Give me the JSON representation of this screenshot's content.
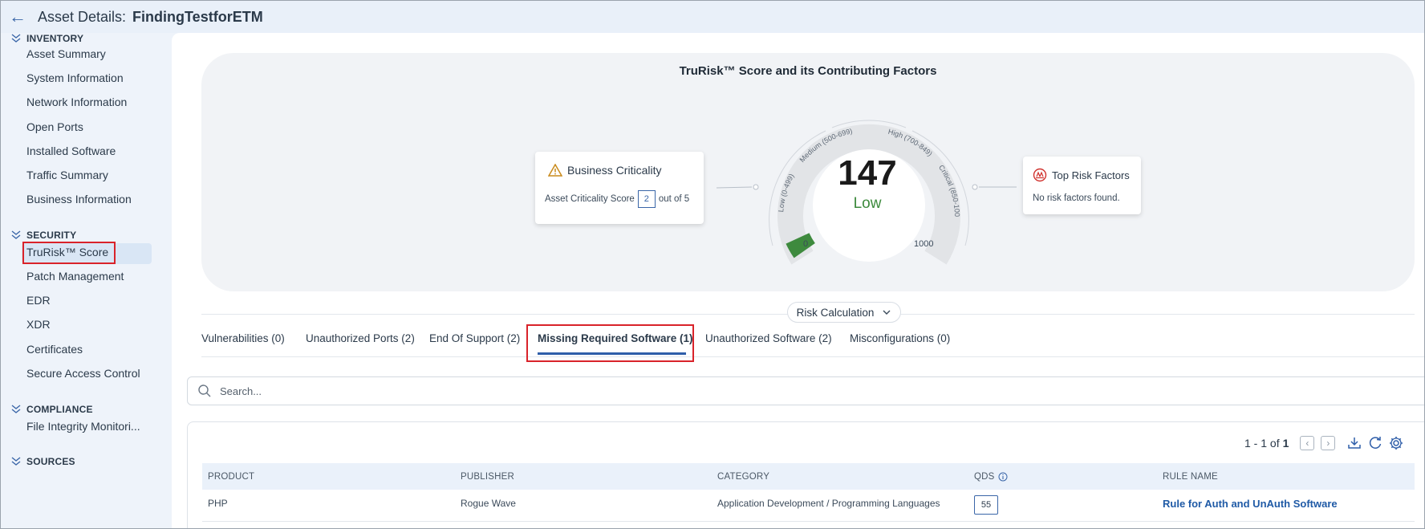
{
  "header": {
    "back_icon": "arrow-left-icon",
    "title_label": "Asset Details:",
    "asset_name": "FindingTestforETM"
  },
  "sidebar": {
    "sections": [
      {
        "title": "INVENTORY",
        "items": [
          "Asset Summary",
          "System Information",
          "Network Information",
          "Open Ports",
          "Installed Software",
          "Traffic Summary",
          "Business Information"
        ]
      },
      {
        "title": "SECURITY",
        "items": [
          "TruRisk™ Score",
          "Patch Management",
          "EDR",
          "XDR",
          "Certificates",
          "Secure Access Control"
        ]
      },
      {
        "title": "COMPLIANCE",
        "items": [
          "File Integrity Monitori..."
        ]
      },
      {
        "title": "SOURCES",
        "items": []
      }
    ],
    "active_item": "TruRisk™ Score"
  },
  "score_card": {
    "title": "TruRisk™ Score and its Contributing Factors",
    "business_criticality": {
      "title": "Business Criticality",
      "label": "Asset Criticality Score",
      "score": "2",
      "suffix": "out of 5"
    },
    "gauge": {
      "score": "147",
      "level": "Low",
      "min": "0",
      "max": "1000",
      "score_value": 147,
      "range_max": 1000,
      "bands": [
        "Low (0-499)",
        "Medium (500-699)",
        "High (700-849)",
        "Critical (850-1000)"
      ],
      "fill_color": "#3e8a3e"
    },
    "top_risk_factors": {
      "title": "Top Risk Factors",
      "message": "No risk factors found."
    }
  },
  "risk_calculation": {
    "label": "Risk Calculation"
  },
  "tabs": [
    {
      "label": "Vulnerabilities (0)",
      "active": false
    },
    {
      "label": "Unauthorized Ports (2)",
      "active": false
    },
    {
      "label": "End Of Support (2)",
      "active": false
    },
    {
      "label": "Missing Required Software (1)",
      "active": true
    },
    {
      "label": "Unauthorized Software (2)",
      "active": false
    },
    {
      "label": "Misconfigurations (0)",
      "active": false
    }
  ],
  "search": {
    "placeholder": "Search..."
  },
  "pager": {
    "range": "1 - 1 of",
    "total": "1"
  },
  "table": {
    "columns": [
      "PRODUCT",
      "PUBLISHER",
      "CATEGORY",
      "QDS",
      "RULE NAME"
    ],
    "rows": [
      {
        "product": "PHP",
        "publisher": "Rogue Wave",
        "category": "Application Development / Programming Languages",
        "qds": "55",
        "rule_name": "Rule for Auth and UnAuth Software"
      }
    ]
  },
  "colors": {
    "accent": "#2f5ea9",
    "highlight_border": "#d9232a",
    "low": "#3d8a3d"
  }
}
